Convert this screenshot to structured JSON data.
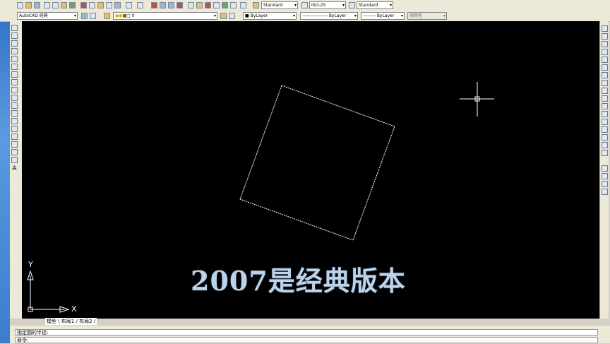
{
  "toolbar": {
    "workspace": "AutoCAD 经典",
    "layer": "0",
    "text_style": "Standard",
    "dim_style": "ISO-25",
    "table_style": "Standard",
    "color": "ByLayer",
    "linetype": "ByLayer",
    "lineweight": "ByLayer",
    "plotstyle": "随颜色"
  },
  "canvas": {
    "overlay_text": "2007是经典版本",
    "ucs_x": "X",
    "ucs_y": "Y",
    "layout_tabs": "模型 \\ 布局1 / 布局2 /"
  },
  "command": {
    "history": "指定圆的半径:",
    "prompt": "命令:"
  },
  "colors": {
    "canvas_bg": "#000000",
    "drawing": "#ffffff",
    "overlay": "#bcd4ea"
  }
}
